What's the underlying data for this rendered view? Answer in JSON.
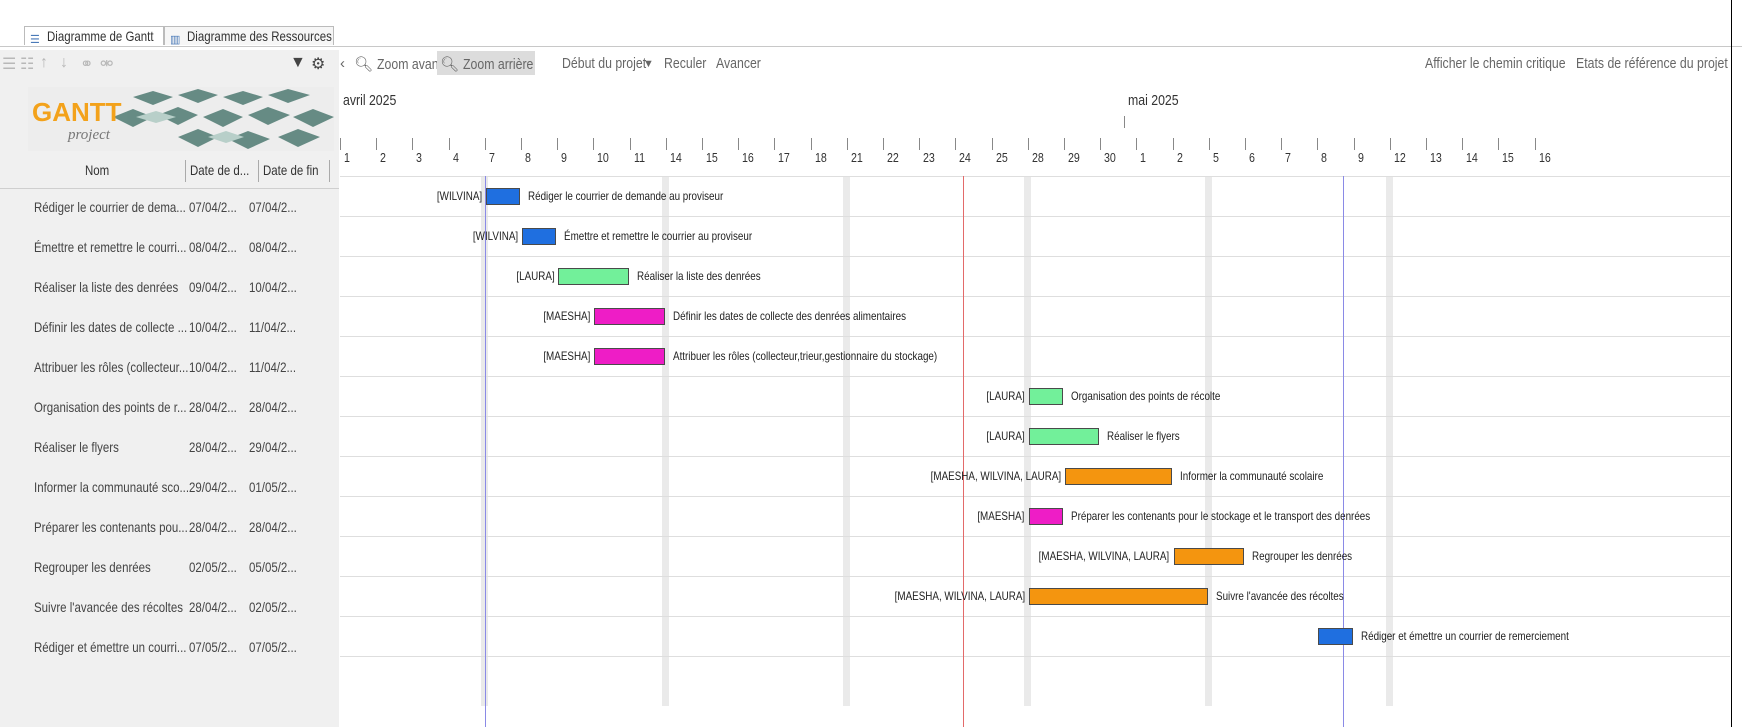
{
  "tabs": [
    {
      "label": "Diagramme de Gantt",
      "icon": "gantt-icon"
    },
    {
      "label": "Diagramme des Ressources",
      "icon": "resources-icon"
    }
  ],
  "logo": {
    "text": "GANTT",
    "sub": "project"
  },
  "table": {
    "columns": [
      "Nom",
      "Date de d...",
      "Date de fin"
    ],
    "rows": [
      {
        "name": "Rédiger le courrier de dema...",
        "start": "07/04/2...",
        "end": "07/04/2..."
      },
      {
        "name": "Émettre et remettre le courri...",
        "start": "08/04/2...",
        "end": "08/04/2..."
      },
      {
        "name": "Réaliser la liste des denrées",
        "start": "09/04/2...",
        "end": "10/04/2..."
      },
      {
        "name": "Définir les dates de collecte ...",
        "start": "10/04/2...",
        "end": "11/04/2..."
      },
      {
        "name": "Attribuer les rôles (collecteur...",
        "start": "10/04/2...",
        "end": "11/04/2..."
      },
      {
        "name": "Organisation des points de r...",
        "start": "28/04/2...",
        "end": "28/04/2..."
      },
      {
        "name": "Réaliser le flyers",
        "start": "28/04/2...",
        "end": "29/04/2..."
      },
      {
        "name": "Informer la communauté sco...",
        "start": "29/04/2...",
        "end": "01/05/2..."
      },
      {
        "name": "Préparer les contenants pou...",
        "start": "28/04/2...",
        "end": "28/04/2..."
      },
      {
        "name": "Regrouper les denrées",
        "start": "02/05/2...",
        "end": "05/05/2..."
      },
      {
        "name": "Suivre l'avancée des récoltes",
        "start": "28/04/2...",
        "end": "02/05/2..."
      },
      {
        "name": "Rédiger et émettre un courri...",
        "start": "07/05/2...",
        "end": "07/05/2..."
      }
    ]
  },
  "toolbar": {
    "zoom_in": "Zoom avant",
    "zoom_out": "Zoom arrière",
    "project_start": "Début du projet",
    "back": "Reculer",
    "forward": "Avancer",
    "critical_path": "Afficher le chemin critique",
    "baselines": "Etats de référence du projet ..."
  },
  "timeline": {
    "month1": "avril 2025",
    "month2": "mai 2025",
    "days": [
      "1",
      "2",
      "3",
      "4",
      "7",
      "8",
      "9",
      "10",
      "11",
      "14",
      "15",
      "16",
      "17",
      "18",
      "21",
      "22",
      "23",
      "24",
      "25",
      "28",
      "29",
      "30",
      "1",
      "2",
      "5",
      "6",
      "7",
      "8",
      "9",
      "12",
      "13",
      "14",
      "15",
      "16"
    ]
  },
  "bars": [
    {
      "start": 4,
      "end": 4,
      "color": "#1f6fe0",
      "resources": "[WILVINA]",
      "label": "Rédiger le courrier de demande au proviseur"
    },
    {
      "start": 5,
      "end": 5,
      "color": "#1f6fe0",
      "resources": "[WILVINA]",
      "label": "Émettre et remettre le courrier au proviseur"
    },
    {
      "start": 6,
      "end": 7,
      "color": "#72f09a",
      "resources": "[LAURA]",
      "label": "Réaliser la liste des denrées"
    },
    {
      "start": 7,
      "end": 8,
      "color": "#ee1dc6",
      "resources": "[MAESHA]",
      "label": "Définir les dates de collecte des denrées alimentaires"
    },
    {
      "start": 7,
      "end": 8,
      "color": "#ee1dc6",
      "resources": "[MAESHA]",
      "label": "Attribuer les rôles (collecteur,trieur,gestionnaire du stockage)"
    },
    {
      "start": 19,
      "end": 19,
      "color": "#72f09a",
      "resources": "[LAURA]",
      "label": "Organisation des points de récolte"
    },
    {
      "start": 19,
      "end": 20,
      "color": "#72f09a",
      "resources": "[LAURA]",
      "label": "Réaliser le flyers"
    },
    {
      "start": 20,
      "end": 22,
      "color": "#f4950f",
      "resources": "[MAESHA, WILVINA, LAURA]",
      "label": "Informer la communauté scolaire"
    },
    {
      "start": 19,
      "end": 19,
      "color": "#ee1dc6",
      "resources": "[MAESHA]",
      "label": "Préparer les contenants pour le stockage et le transport des denrées"
    },
    {
      "start": 23,
      "end": 24,
      "color": "#f4950f",
      "resources": "[MAESHA, WILVINA, LAURA]",
      "label": "Regrouper les denrées"
    },
    {
      "start": 19,
      "end": 23,
      "color": "#f4950f",
      "resources": "[MAESHA, WILVINA, LAURA]",
      "label": "Suivre l'avancée des récoltes"
    },
    {
      "start": 27,
      "end": 27,
      "color": "#1f6fe0",
      "resources": "",
      "label": "Rédiger et émettre un courrier de remerciement"
    }
  ]
}
